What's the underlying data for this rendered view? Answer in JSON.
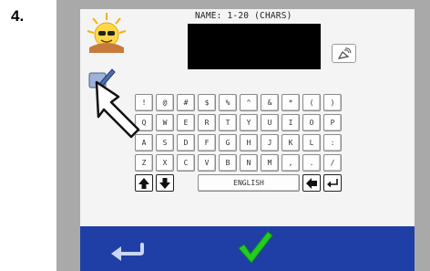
{
  "step": {
    "number": "4."
  },
  "header": {
    "name_label": "NAME: 1-20 (CHARS)",
    "name_value": ""
  },
  "keyboard": {
    "row1": [
      "!",
      "@",
      "#",
      "$",
      "%",
      "^",
      "&",
      "*",
      "(",
      ")"
    ],
    "row2": [
      "Q",
      "W",
      "E",
      "R",
      "T",
      "Y",
      "U",
      "I",
      "O",
      "P"
    ],
    "row3": [
      "A",
      "S",
      "D",
      "F",
      "G",
      "H",
      "J",
      "K",
      "L",
      ":"
    ],
    "row4": [
      "Z",
      "X",
      "C",
      "V",
      "B",
      "N",
      "M",
      ",",
      ".",
      "/"
    ],
    "language_label": "ENGLISH"
  },
  "icons": {
    "sun": "sun-with-glasses-icon",
    "dish": "satellite-dish-icon",
    "pencil": "edit-pencil-icon",
    "shift_up": "arrow-up-icon",
    "shift_down": "arrow-down-icon",
    "backspace": "backspace-arrow-icon",
    "enter": "enter-return-icon",
    "back": "back-arrow-icon",
    "ok": "green-checkmark-icon",
    "cursor": "hand-pointer-cursor-icon"
  },
  "colors": {
    "bottom_bar": "#1f3fa7",
    "frame": "#a9a9a9",
    "confirm": "#22cc22"
  }
}
